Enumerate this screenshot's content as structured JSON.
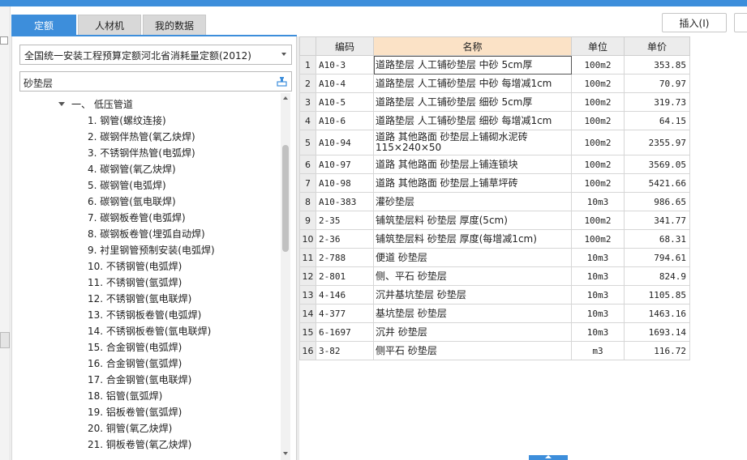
{
  "tabs": [
    "定额",
    "人材机",
    "我的数据"
  ],
  "active_tab": "定额",
  "toolbar": {
    "insert_label": "插入(I)"
  },
  "library_select": {
    "value": "全国统一安装工程预算定额河北省消耗量定额(2012)"
  },
  "search": {
    "value": "砂垫层"
  },
  "tree": {
    "root": "一、 低压管道",
    "items": [
      "1. 钢管(螺纹连接)",
      "2. 碳钢伴热管(氧乙炔焊)",
      "3. 不锈钢伴热管(电弧焊)",
      "4. 碳钢管(氧乙炔焊)",
      "5. 碳钢管(电弧焊)",
      "6. 碳钢管(氩电联焊)",
      "7. 碳钢板卷管(电弧焊)",
      "8. 碳钢板卷管(埋弧自动焊)",
      "9. 衬里钢管预制安装(电弧焊)",
      "10. 不锈钢管(电弧焊)",
      "11. 不锈钢管(氩弧焊)",
      "12. 不锈钢管(氩电联焊)",
      "13. 不锈钢板卷管(电弧焊)",
      "14. 不锈钢板卷管(氩电联焊)",
      "15. 合金钢管(电弧焊)",
      "16. 合金钢管(氩弧焊)",
      "17. 合金钢管(氩电联焊)",
      "18. 铝管(氩弧焊)",
      "19. 铝板卷管(氩弧焊)",
      "20. 铜管(氧乙炔焊)",
      "21. 铜板卷管(氧乙炔焊)"
    ]
  },
  "table": {
    "headers": [
      "",
      "编码",
      "名称",
      "单位",
      "单价"
    ],
    "rows": [
      {
        "n": "1",
        "code": "A10-3",
        "name": "道路垫层 人工铺砂垫层 中砂 5cm厚",
        "unit": "100m2",
        "price": "353.85"
      },
      {
        "n": "2",
        "code": "A10-4",
        "name": "道路垫层 人工铺砂垫层 中砂 每增减1cm",
        "unit": "100m2",
        "price": "70.97"
      },
      {
        "n": "3",
        "code": "A10-5",
        "name": "道路垫层 人工铺砂垫层 细砂 5cm厚",
        "unit": "100m2",
        "price": "319.73"
      },
      {
        "n": "4",
        "code": "A10-6",
        "name": "道路垫层 人工铺砂垫层 细砂 每增减1cm",
        "unit": "100m2",
        "price": "64.15"
      },
      {
        "n": "5",
        "code": "A10-94",
        "name": "道路 其他路面 砂垫层上铺砌水泥砖 115×240×50",
        "unit": "100m2",
        "price": "2355.97"
      },
      {
        "n": "6",
        "code": "A10-97",
        "name": "道路 其他路面 砂垫层上铺连锁块",
        "unit": "100m2",
        "price": "3569.05"
      },
      {
        "n": "7",
        "code": "A10-98",
        "name": "道路 其他路面 砂垫层上铺草坪砖",
        "unit": "100m2",
        "price": "5421.66"
      },
      {
        "n": "8",
        "code": "A10-383",
        "name": "灌砂垫层",
        "unit": "10m3",
        "price": "986.65"
      },
      {
        "n": "9",
        "code": "2-35",
        "name": "铺筑垫层料 砂垫层 厚度(5cm)",
        "unit": "100m2",
        "price": "341.77"
      },
      {
        "n": "10",
        "code": "2-36",
        "name": "铺筑垫层料 砂垫层 厚度(每增减1cm)",
        "unit": "100m2",
        "price": "68.31"
      },
      {
        "n": "11",
        "code": "2-788",
        "name": "便道 砂垫层",
        "unit": "10m3",
        "price": "794.61"
      },
      {
        "n": "12",
        "code": "2-801",
        "name": "侧、平石 砂垫层",
        "unit": "10m3",
        "price": "824.9"
      },
      {
        "n": "13",
        "code": "4-146",
        "name": "沉井基坑垫层 砂垫层",
        "unit": "10m3",
        "price": "1105.85"
      },
      {
        "n": "14",
        "code": "4-377",
        "name": "基坑垫层 砂垫层",
        "unit": "10m3",
        "price": "1463.16"
      },
      {
        "n": "15",
        "code": "6-1697",
        "name": "沉井 砂垫层",
        "unit": "10m3",
        "price": "1693.14"
      },
      {
        "n": "16",
        "code": "3-82",
        "name": "侧平石 砂垫层",
        "unit": "m3",
        "price": "116.72"
      }
    ]
  },
  "colors": {
    "accent": "#3d8edb",
    "name_header": "#fbe2c6"
  },
  "icons": {
    "search": "stamp-icon",
    "select_caret": "chevron-down-icon"
  }
}
